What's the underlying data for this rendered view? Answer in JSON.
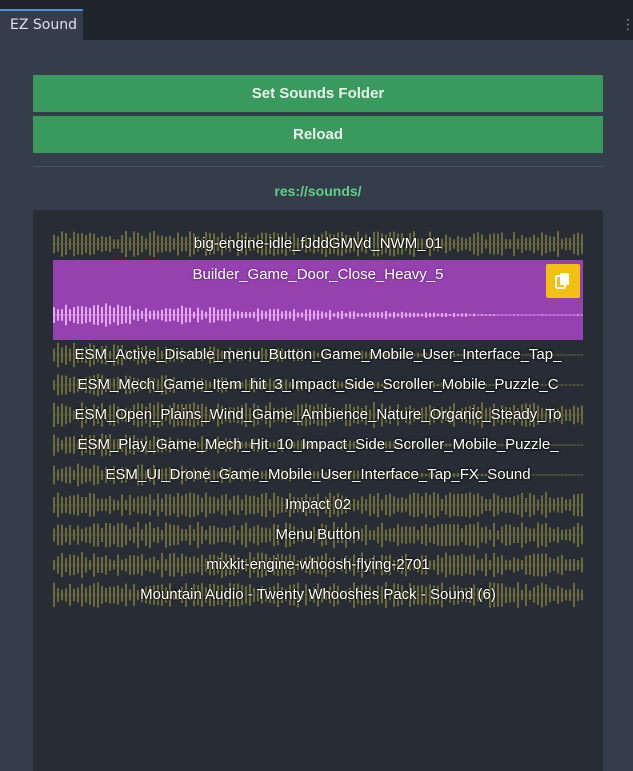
{
  "tab": {
    "title": "EZ Sound",
    "menu_glyph": "⋮"
  },
  "buttons": {
    "set_folder": "Set Sounds Folder",
    "reload": "Reload"
  },
  "folder_path": "res://sounds/",
  "sounds": [
    {
      "name": "big-engine-idle_fJddGMVd_NWM_01",
      "selected": false
    },
    {
      "name": "Builder_Game_Door_Close_Heavy_5",
      "selected": true
    },
    {
      "name": "ESM_Active_Disable_menu_Button_Game_Mobile_User_Interface_Tap_",
      "selected": false
    },
    {
      "name": "ESM_Mech_Game_Item_hit_3_Impact_Side_Scroller_Mobile_Puzzle_C",
      "selected": false
    },
    {
      "name": "ESM_Open_Plains_Wind_Game_Ambience_Nature_Organic_Steady_To",
      "selected": false
    },
    {
      "name": "ESM_Play_Game_Mech_Hit_10_Impact_Side_Scroller_Mobile_Puzzle_",
      "selected": false
    },
    {
      "name": "ESM_UI_Drone_Game_Mobile_User_Interface_Tap_FX_Sound",
      "selected": false
    },
    {
      "name": "Impact 02",
      "selected": false
    },
    {
      "name": "Menu Button",
      "selected": false
    },
    {
      "name": "mixkit-engine-whoosh-flying-2701",
      "selected": false
    },
    {
      "name": "Mountain Audio - Twenty Whooshes Pack - Sound (6)",
      "selected": false
    }
  ],
  "colors": {
    "accent_button": "#3a9a5e",
    "path_text": "#5fd18b",
    "selected_row": "#9542b0",
    "waveform": "#6b6a3c",
    "selected_waveform": "#e5a6f0",
    "copy_button": "#f2c010"
  },
  "icons": {
    "copy": "copy-icon",
    "menu": "kebab-menu-icon"
  }
}
